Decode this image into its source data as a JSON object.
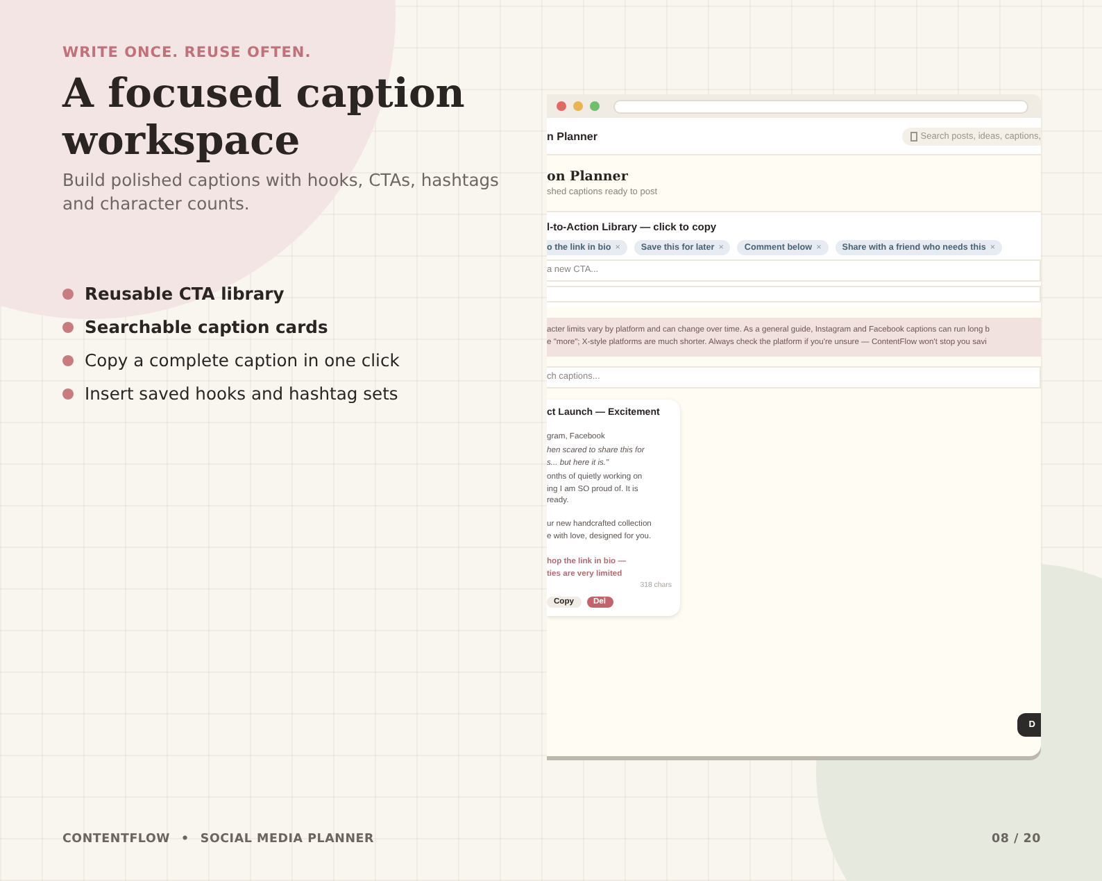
{
  "eyebrow": "WRITE ONCE. REUSE OFTEN.",
  "title": "A focused caption workspace",
  "subtitle": "Build polished captions with hooks, CTAs, hashtags and character counts.",
  "features": [
    {
      "text": "Reusable CTA library",
      "emphasized": true
    },
    {
      "text": "Searchable caption cards",
      "emphasized": true
    },
    {
      "text": "Copy a complete caption in one click",
      "emphasized": false
    },
    {
      "text": "Insert saved hooks and hashtag sets",
      "emphasized": false
    }
  ],
  "app": {
    "header_title": "n Planner",
    "search_placeholder": "Search posts, ideas, captions,",
    "page_title": "on Planner",
    "page_subtitle": "shed captions ready to post",
    "cta_library": {
      "title": "l-to-Action Library — click to copy",
      "chips": [
        {
          "label": "o the link in bio",
          "remove": "×"
        },
        {
          "label": "Save this for later",
          "remove": "×"
        },
        {
          "label": "Comment below",
          "remove": "×"
        },
        {
          "label": "Share with a friend who needs this",
          "remove": "×"
        }
      ],
      "input_placeholder": "a new CTA..."
    },
    "notice_lines": [
      "acter limits vary by platform and can change over time. As a general guide, Instagram and Facebook captions can run long b",
      "e \"more\"; X-style platforms are much shorter. Always check the platform if you're unsure — ContentFlow won't stop you savi"
    ],
    "caption_search_placeholder": "ch captions...",
    "caption_card": {
      "title": "ct Launch — Excitement",
      "platforms": "gram, Facebook",
      "hook": "hen scared to share this for\ns... but here it is.\"",
      "body": "onths of quietly working on\ning I am SO proud of. It is\nready.\n\nur new handcrafted collection\ne with love, designed for you.",
      "cta": "hop the link in bio —\nties are very limited",
      "count": "318 chars",
      "buttons": [
        {
          "label": "Copy",
          "kind": "plain"
        },
        {
          "label": "Del",
          "kind": "danger"
        }
      ]
    },
    "floating_button": "D"
  },
  "footer": {
    "brand": "CONTENTFLOW",
    "separator": "•",
    "product": "SOCIAL MEDIA PLANNER",
    "page": "08 / 20"
  }
}
